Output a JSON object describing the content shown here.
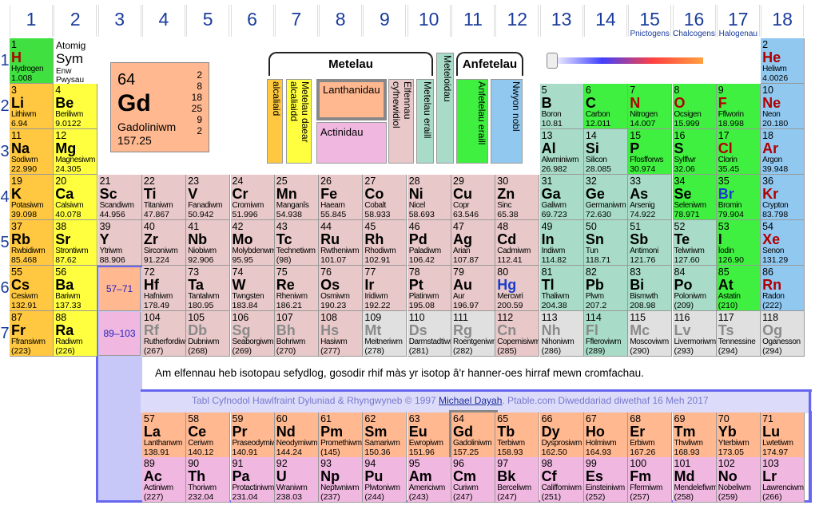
{
  "title": "Tabl Cyfnodol",
  "groups": [
    "1",
    "2",
    "3",
    "4",
    "5",
    "6",
    "7",
    "8",
    "9",
    "10",
    "11",
    "12",
    "13",
    "14",
    "15",
    "16",
    "17",
    "18"
  ],
  "group_subtitles": {
    "15": "Pnictogens",
    "16": "Chalcogens",
    "17": "Halogenau"
  },
  "periods": [
    "1",
    "2",
    "3",
    "4",
    "5",
    "6",
    "7"
  ],
  "legend_sample": {
    "label_atomig": "Atomig",
    "label_sym": "Sym",
    "label_enw": "Enw",
    "label_pwysau": "Pwysau"
  },
  "selected": {
    "z": "64",
    "sym": "Gd",
    "name": "Gadoliniwm",
    "mass": "157.25",
    "shells": [
      "2",
      "8",
      "18",
      "25",
      "9",
      "2"
    ]
  },
  "categories": {
    "metelau": "Metelau",
    "anfetelau": "Anfetelau",
    "alcaliaid": "alcaliaid",
    "ae": "Metelau daear alcaliaidd",
    "lan": "Lanthanidau",
    "act": "Actinidau",
    "elf": "Elfennau cyfnewidiol",
    "metelau_eraill": "Metelau eraill",
    "meteloidau": "Meteloidau",
    "anf_eraill": "Anfetelau eraill",
    "nwyon": "Nwyon nobl"
  },
  "refs": {
    "lan": "57–71",
    "act": "89–103"
  },
  "note": "Am elfennau heb isotopau sefydlog, gosodir rhif màs yr isotop â'r hanner-oes hirraf mewn cromfachau.",
  "footer": {
    "pre": "Tabl Cyfnodol Hawlfraint Dyluniad & Rhyngwyneb © 1997 ",
    "link": "Michael Dayah",
    "post": ". Ptable.com Diweddariad diwethaf 16 Meh 2017"
  },
  "colors": {
    "accent": "#6666ee",
    "alk": "#ffc840",
    "ae": "#ffff40",
    "tm": "#e8c8c8",
    "nm": "#40f040",
    "ng": "#90c8f0",
    "lan": "#ffb890",
    "act": "#f0b8e0"
  },
  "elements": [
    [
      "1",
      "H",
      "Hydrogen",
      "1.008",
      "h",
      1,
      1,
      "red"
    ],
    [
      "2",
      "He",
      "Heliwm",
      "4.0026",
      "ng",
      18,
      1,
      "red"
    ],
    [
      "3",
      "Li",
      "Lithiwm",
      "6.94",
      "alk",
      1,
      2,
      ""
    ],
    [
      "4",
      "Be",
      "Beriliwm",
      "9.0122",
      "ae",
      2,
      2,
      ""
    ],
    [
      "5",
      "B",
      "Boron",
      "10.81",
      "md",
      13,
      2,
      ""
    ],
    [
      "6",
      "C",
      "Carbon",
      "12.011",
      "nm",
      14,
      2,
      ""
    ],
    [
      "7",
      "N",
      "Nitrogen",
      "14.007",
      "nm",
      15,
      2,
      "red"
    ],
    [
      "8",
      "O",
      "Ocsigen",
      "15.999",
      "nm",
      16,
      2,
      "red"
    ],
    [
      "9",
      "F",
      "Fflworin",
      "18.998",
      "hal",
      17,
      2,
      "red"
    ],
    [
      "10",
      "Ne",
      "Neon",
      "20.180",
      "ng",
      18,
      2,
      "red"
    ],
    [
      "11",
      "Na",
      "Sodiwm",
      "22.990",
      "alk",
      1,
      3,
      ""
    ],
    [
      "12",
      "Mg",
      "Magnesiwm",
      "24.305",
      "ae",
      2,
      3,
      ""
    ],
    [
      "13",
      "Al",
      "Alwminiwm",
      "26.982",
      "pt",
      13,
      3,
      ""
    ],
    [
      "14",
      "Si",
      "Silicon",
      "28.085",
      "md",
      14,
      3,
      ""
    ],
    [
      "15",
      "P",
      "Ffosfforws",
      "30.974",
      "nm",
      15,
      3,
      ""
    ],
    [
      "16",
      "S",
      "Sylffwr",
      "32.06",
      "nm",
      16,
      3,
      ""
    ],
    [
      "17",
      "Cl",
      "Clorin",
      "35.45",
      "hal",
      17,
      3,
      "red"
    ],
    [
      "18",
      "Ar",
      "Argon",
      "39.948",
      "ng",
      18,
      3,
      "red"
    ],
    [
      "19",
      "K",
      "Potasiwm",
      "39.098",
      "alk",
      1,
      4,
      ""
    ],
    [
      "20",
      "Ca",
      "Calsiwm",
      "40.078",
      "ae",
      2,
      4,
      ""
    ],
    [
      "21",
      "Sc",
      "Scandiwm",
      "44.956",
      "tm",
      3,
      4,
      ""
    ],
    [
      "22",
      "Ti",
      "Titaniwm",
      "47.867",
      "tm",
      4,
      4,
      ""
    ],
    [
      "23",
      "V",
      "Fanadiwm",
      "50.942",
      "tm",
      5,
      4,
      ""
    ],
    [
      "24",
      "Cr",
      "Cromiwm",
      "51.996",
      "tm",
      6,
      4,
      ""
    ],
    [
      "25",
      "Mn",
      "Manganîs",
      "54.938",
      "tm",
      7,
      4,
      ""
    ],
    [
      "26",
      "Fe",
      "Haearn",
      "55.845",
      "tm",
      8,
      4,
      ""
    ],
    [
      "27",
      "Co",
      "Cobalt",
      "58.933",
      "tm",
      9,
      4,
      ""
    ],
    [
      "28",
      "Ni",
      "Nicel",
      "58.693",
      "tm",
      10,
      4,
      ""
    ],
    [
      "29",
      "Cu",
      "Copr",
      "63.546",
      "tm",
      11,
      4,
      ""
    ],
    [
      "30",
      "Zn",
      "Sinc",
      "65.38",
      "tm",
      12,
      4,
      ""
    ],
    [
      "31",
      "Ga",
      "Galiwm",
      "69.723",
      "pt",
      13,
      4,
      ""
    ],
    [
      "32",
      "Ge",
      "Germaniwm",
      "72.630",
      "md",
      14,
      4,
      ""
    ],
    [
      "33",
      "As",
      "Arsenig",
      "74.922",
      "md",
      15,
      4,
      ""
    ],
    [
      "34",
      "Se",
      "Seleniwm",
      "78.971",
      "nm",
      16,
      4,
      ""
    ],
    [
      "35",
      "Br",
      "Bromin",
      "79.904",
      "hal",
      17,
      4,
      "blue"
    ],
    [
      "36",
      "Kr",
      "Crypton",
      "83.798",
      "ng",
      18,
      4,
      "red"
    ],
    [
      "37",
      "Rb",
      "Rwbidiwm",
      "85.468",
      "alk",
      1,
      5,
      ""
    ],
    [
      "38",
      "Sr",
      "Strontiwm",
      "87.62",
      "ae",
      2,
      5,
      ""
    ],
    [
      "39",
      "Y",
      "Ytriwm",
      "88.906",
      "tm",
      3,
      5,
      ""
    ],
    [
      "40",
      "Zr",
      "Sirconiwm",
      "91.224",
      "tm",
      4,
      5,
      ""
    ],
    [
      "41",
      "Nb",
      "Niobiwm",
      "92.906",
      "tm",
      5,
      5,
      ""
    ],
    [
      "42",
      "Mo",
      "Molybdenwm",
      "95.95",
      "tm",
      6,
      5,
      ""
    ],
    [
      "43",
      "Tc",
      "Technetiwm",
      "(98)",
      "tm",
      7,
      5,
      ""
    ],
    [
      "44",
      "Ru",
      "Rwtheniwm",
      "101.07",
      "tm",
      8,
      5,
      ""
    ],
    [
      "45",
      "Rh",
      "Rhodiwm",
      "102.91",
      "tm",
      9,
      5,
      ""
    ],
    [
      "46",
      "Pd",
      "Paladiwm",
      "106.42",
      "tm",
      10,
      5,
      ""
    ],
    [
      "47",
      "Ag",
      "Arian",
      "107.87",
      "tm",
      11,
      5,
      ""
    ],
    [
      "48",
      "Cd",
      "Cadmiwm",
      "112.41",
      "tm",
      12,
      5,
      ""
    ],
    [
      "49",
      "In",
      "Indiwm",
      "114.82",
      "pt",
      13,
      5,
      ""
    ],
    [
      "50",
      "Sn",
      "Tun",
      "118.71",
      "pt",
      14,
      5,
      ""
    ],
    [
      "51",
      "Sb",
      "Antimoni",
      "121.76",
      "md",
      15,
      5,
      ""
    ],
    [
      "52",
      "Te",
      "Telwriwm",
      "127.60",
      "md",
      16,
      5,
      ""
    ],
    [
      "53",
      "I",
      "Ïodin",
      "126.90",
      "hal",
      17,
      5,
      ""
    ],
    [
      "54",
      "Xe",
      "Senon",
      "131.29",
      "ng",
      18,
      5,
      "red"
    ],
    [
      "55",
      "Cs",
      "Cesiwm",
      "132.91",
      "alk",
      1,
      6,
      ""
    ],
    [
      "56",
      "Ba",
      "Bariwm",
      "137.33",
      "ae",
      2,
      6,
      ""
    ],
    [
      "72",
      "Hf",
      "Hafniwm",
      "178.49",
      "tm",
      4,
      6,
      ""
    ],
    [
      "73",
      "Ta",
      "Tantalwm",
      "180.95",
      "tm",
      5,
      6,
      ""
    ],
    [
      "74",
      "W",
      "Twngsten",
      "183.84",
      "tm",
      6,
      6,
      ""
    ],
    [
      "75",
      "Re",
      "Rheniwm",
      "186.21",
      "tm",
      7,
      6,
      ""
    ],
    [
      "76",
      "Os",
      "Osmiwm",
      "190.23",
      "tm",
      8,
      6,
      ""
    ],
    [
      "77",
      "Ir",
      "Iridiwm",
      "192.22",
      "tm",
      9,
      6,
      ""
    ],
    [
      "78",
      "Pt",
      "Platinwm",
      "195.08",
      "tm",
      10,
      6,
      ""
    ],
    [
      "79",
      "Au",
      "Aur",
      "196.97",
      "tm",
      11,
      6,
      ""
    ],
    [
      "80",
      "Hg",
      "Mercwri",
      "200.59",
      "tm",
      12,
      6,
      "blue"
    ],
    [
      "81",
      "Tl",
      "Thaliwm",
      "204.38",
      "pt",
      13,
      6,
      ""
    ],
    [
      "82",
      "Pb",
      "Plwm",
      "207.2",
      "pt",
      14,
      6,
      ""
    ],
    [
      "83",
      "Bi",
      "Bismwth",
      "208.98",
      "pt",
      15,
      6,
      ""
    ],
    [
      "84",
      "Po",
      "Poloniwm",
      "(209)",
      "pt",
      16,
      6,
      ""
    ],
    [
      "85",
      "At",
      "Astatin",
      "(210)",
      "hal",
      17,
      6,
      ""
    ],
    [
      "86",
      "Rn",
      "Radon",
      "(222)",
      "ng",
      18,
      6,
      "red"
    ],
    [
      "87",
      "Fr",
      "Ffransiwm",
      "(223)",
      "alk",
      1,
      7,
      ""
    ],
    [
      "88",
      "Ra",
      "Radiwm",
      "(226)",
      "ae",
      2,
      7,
      ""
    ],
    [
      "104",
      "Rf",
      "Rutherfordiwm",
      "(267)",
      "tm",
      4,
      7,
      "gray"
    ],
    [
      "105",
      "Db",
      "Dubniwm",
      "(268)",
      "tm",
      5,
      7,
      "gray"
    ],
    [
      "106",
      "Sg",
      "Seaborgiwm",
      "(269)",
      "tm",
      6,
      7,
      "gray"
    ],
    [
      "107",
      "Bh",
      "Bohriwm",
      "(270)",
      "tm",
      7,
      7,
      "gray"
    ],
    [
      "108",
      "Hs",
      "Hasiwm",
      "(277)",
      "tm",
      8,
      7,
      "gray"
    ],
    [
      "109",
      "Mt",
      "Meitneriwm",
      "(278)",
      "unk",
      9,
      7,
      "gray"
    ],
    [
      "110",
      "Ds",
      "Darmstadtiwm",
      "(281)",
      "unk",
      10,
      7,
      "gray"
    ],
    [
      "111",
      "Rg",
      "Roentgeniwm",
      "(282)",
      "unk",
      11,
      7,
      "gray"
    ],
    [
      "112",
      "Cn",
      "Copernisiwm",
      "(285)",
      "tm",
      12,
      7,
      "gray"
    ],
    [
      "113",
      "Nh",
      "Nihoniwm",
      "(286)",
      "unk",
      13,
      7,
      "gray"
    ],
    [
      "114",
      "Fl",
      "Ffleroviwm",
      "(289)",
      "pt",
      14,
      7,
      "gray"
    ],
    [
      "115",
      "Mc",
      "Moscoviwm",
      "(290)",
      "unk",
      15,
      7,
      "gray"
    ],
    [
      "116",
      "Lv",
      "Livermoriwm",
      "(293)",
      "unk",
      16,
      7,
      "gray"
    ],
    [
      "117",
      "Ts",
      "Tennessine",
      "(294)",
      "unk",
      17,
      7,
      "gray"
    ],
    [
      "118",
      "Og",
      "Oganesson",
      "(294)",
      "unk",
      18,
      7,
      "gray"
    ],
    [
      "57",
      "La",
      "Lanthanwm",
      "138.91",
      "lan",
      4,
      9,
      ""
    ],
    [
      "58",
      "Ce",
      "Ceriwm",
      "140.12",
      "lan",
      5,
      9,
      ""
    ],
    [
      "59",
      "Pr",
      "Praseodymiwm",
      "140.91",
      "lan",
      6,
      9,
      ""
    ],
    [
      "60",
      "Nd",
      "Neodymiwm",
      "144.24",
      "lan",
      7,
      9,
      ""
    ],
    [
      "61",
      "Pm",
      "Promethiwm",
      "(145)",
      "lan",
      8,
      9,
      ""
    ],
    [
      "62",
      "Sm",
      "Samariwm",
      "150.36",
      "lan",
      9,
      9,
      ""
    ],
    [
      "63",
      "Eu",
      "Ewropiwm",
      "151.96",
      "lan",
      10,
      9,
      ""
    ],
    [
      "64",
      "Gd",
      "Gadoliniwm",
      "157.25",
      "lan",
      11,
      9,
      ""
    ],
    [
      "65",
      "Tb",
      "Terbiwm",
      "158.93",
      "lan",
      12,
      9,
      ""
    ],
    [
      "66",
      "Dy",
      "Dysprosiwm",
      "162.50",
      "lan",
      13,
      9,
      ""
    ],
    [
      "67",
      "Ho",
      "Holmiwm",
      "164.93",
      "lan",
      14,
      9,
      ""
    ],
    [
      "68",
      "Er",
      "Erbiwm",
      "167.26",
      "lan",
      15,
      9,
      ""
    ],
    [
      "69",
      "Tm",
      "Thwliwm",
      "168.93",
      "lan",
      16,
      9,
      ""
    ],
    [
      "70",
      "Yb",
      "Yterbiwm",
      "173.05",
      "lan",
      17,
      9,
      ""
    ],
    [
      "71",
      "Lu",
      "Lwtetiwm",
      "174.97",
      "lan",
      18,
      9,
      ""
    ],
    [
      "89",
      "Ac",
      "Actiniwm",
      "(227)",
      "act",
      4,
      10,
      ""
    ],
    [
      "90",
      "Th",
      "Thoriwm",
      "232.04",
      "act",
      5,
      10,
      ""
    ],
    [
      "91",
      "Pa",
      "Protactiniwm",
      "231.04",
      "act",
      6,
      10,
      ""
    ],
    [
      "92",
      "U",
      "Wraniwm",
      "238.03",
      "act",
      7,
      10,
      ""
    ],
    [
      "93",
      "Np",
      "Neptwniwm",
      "(237)",
      "act",
      8,
      10,
      ""
    ],
    [
      "94",
      "Pu",
      "Plwtoniwm",
      "(244)",
      "act",
      9,
      10,
      ""
    ],
    [
      "95",
      "Am",
      "Americiwm",
      "(243)",
      "act",
      10,
      10,
      ""
    ],
    [
      "96",
      "Cm",
      "Curiwm",
      "(247)",
      "act",
      11,
      10,
      ""
    ],
    [
      "97",
      "Bk",
      "Berceliwm",
      "(247)",
      "act",
      12,
      10,
      ""
    ],
    [
      "98",
      "Cf",
      "Califforniwm",
      "(251)",
      "act",
      13,
      10,
      ""
    ],
    [
      "99",
      "Es",
      "Einsteiniwm",
      "(252)",
      "act",
      14,
      10,
      ""
    ],
    [
      "100",
      "Fm",
      "Ffermiwm",
      "(257)",
      "act",
      15,
      10,
      ""
    ],
    [
      "101",
      "Md",
      "Mendelefiwm",
      "(258)",
      "act",
      16,
      10,
      ""
    ],
    [
      "102",
      "No",
      "Nobeliwm",
      "(259)",
      "act",
      17,
      10,
      ""
    ],
    [
      "103",
      "Lr",
      "Lawrenciwm",
      "(266)",
      "act",
      18,
      10,
      ""
    ]
  ]
}
